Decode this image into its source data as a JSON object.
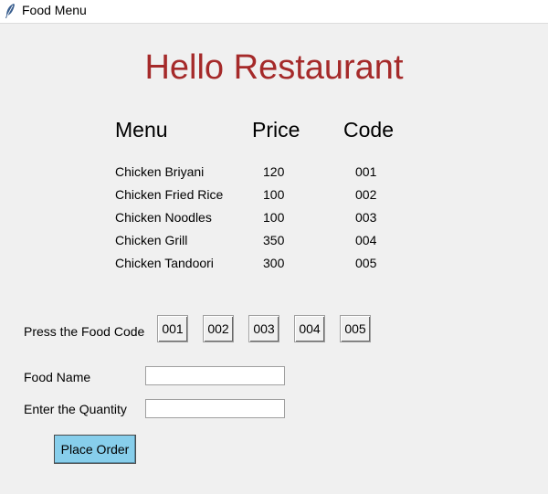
{
  "window": {
    "title": "Food Menu",
    "icon": "feather-icon"
  },
  "heading": "Hello Restaurant",
  "menu_table": {
    "headers": {
      "menu": "Menu",
      "price": "Price",
      "code": "Code"
    },
    "rows": [
      {
        "name": "Chicken Briyani",
        "price": "120",
        "code": "001"
      },
      {
        "name": "Chicken Fried Rice",
        "price": "100",
        "code": "002"
      },
      {
        "name": "Chicken Noodles",
        "price": "100",
        "code": "003"
      },
      {
        "name": "Chicken Grill",
        "price": "350",
        "code": "004"
      },
      {
        "name": "Chicken Tandoori",
        "price": "300",
        "code": "005"
      }
    ]
  },
  "code_section": {
    "label": "Press the Food Code",
    "buttons": [
      "001",
      "002",
      "003",
      "004",
      "005"
    ]
  },
  "form": {
    "food_name_label": "Food Name",
    "food_name_value": "",
    "quantity_label": "Enter the Quantity",
    "quantity_value": ""
  },
  "place_order_label": "Place Order",
  "colors": {
    "heading": "#a52a2a",
    "place_order_bg": "#87ceeb",
    "window_bg": "#f0f0f0"
  }
}
